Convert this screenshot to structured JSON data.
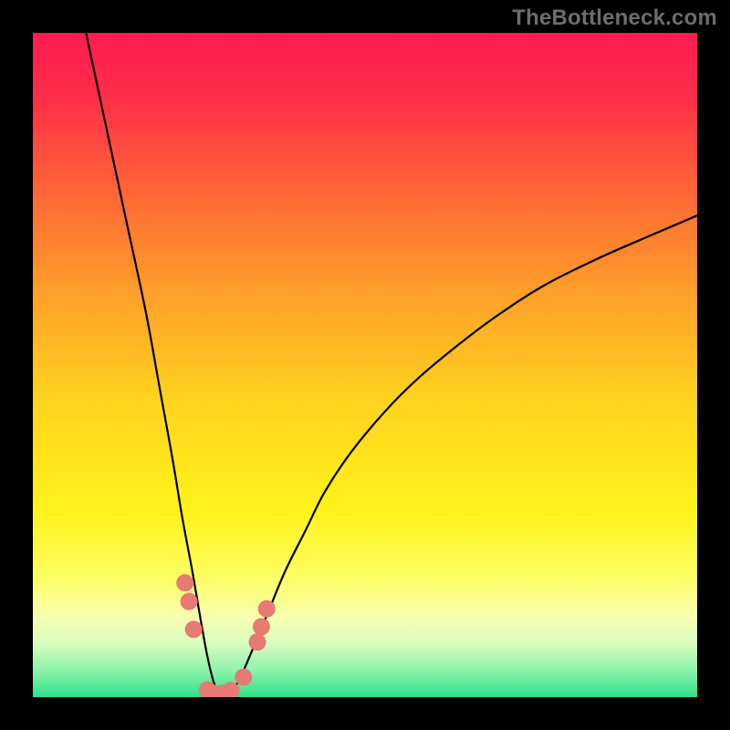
{
  "watermark": "TheBottleneck.com",
  "chart_data": {
    "type": "line",
    "title": "",
    "xlabel": "",
    "ylabel": "",
    "xlim": [
      0,
      100
    ],
    "ylim": [
      0,
      100
    ],
    "gradient_stops": [
      {
        "offset": 0.0,
        "color": "#ff1a52"
      },
      {
        "offset": 0.1,
        "color": "#ff2f49"
      },
      {
        "offset": 0.25,
        "color": "#ff6a35"
      },
      {
        "offset": 0.4,
        "color": "#ffa229"
      },
      {
        "offset": 0.55,
        "color": "#ffd21f"
      },
      {
        "offset": 0.72,
        "color": "#fff31a"
      },
      {
        "offset": 0.82,
        "color": "#fdfe63"
      },
      {
        "offset": 0.88,
        "color": "#f7ffb0"
      },
      {
        "offset": 0.92,
        "color": "#d8fcc0"
      },
      {
        "offset": 0.96,
        "color": "#8cf3ab"
      },
      {
        "offset": 1.0,
        "color": "#2de08a"
      }
    ],
    "series": [
      {
        "name": "bottleneck-curve",
        "x": [
          8,
          11,
          14,
          17,
          19,
          21,
          22.5,
          24,
          25.2,
          26.3,
          27.3,
          28.2,
          29.2,
          31,
          33,
          35.5,
          38,
          41,
          44,
          48,
          53,
          58,
          64,
          70,
          77,
          85,
          93,
          100
        ],
        "y": [
          100,
          86,
          72,
          58,
          47,
          36,
          27,
          19,
          12,
          6,
          2,
          0,
          0,
          2.5,
          7,
          13,
          19,
          25,
          31,
          37,
          43,
          48,
          53,
          57.5,
          62,
          66,
          69.5,
          72.5
        ]
      }
    ],
    "markers": {
      "name": "highlight-dots",
      "color": "#e77a72",
      "points": [
        {
          "x": 22.9,
          "y": 17.2
        },
        {
          "x": 23.5,
          "y": 14.4
        },
        {
          "x": 24.2,
          "y": 10.2
        },
        {
          "x": 26.3,
          "y": 1.1
        },
        {
          "x": 27.4,
          "y": 0.5
        },
        {
          "x": 28.6,
          "y": 0.6
        },
        {
          "x": 29.8,
          "y": 1.0
        },
        {
          "x": 31.7,
          "y": 3.0
        },
        {
          "x": 33.8,
          "y": 8.3
        },
        {
          "x": 34.4,
          "y": 10.6
        },
        {
          "x": 35.2,
          "y": 13.3
        }
      ]
    }
  }
}
